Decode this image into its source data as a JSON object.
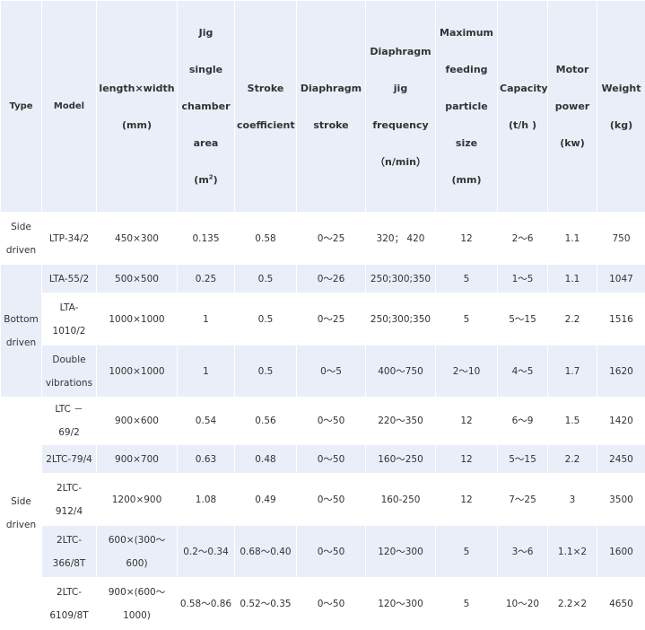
{
  "headers": {
    "type": "Type",
    "model": "Model",
    "length_width": "length×width",
    "length_width_unit": "(mm)",
    "jig_area_l1": "Jig",
    "jig_area_l2": "single",
    "jig_area_l3": "chamber",
    "jig_area_l4": "area",
    "jig_area_unit_pre": "(m",
    "jig_area_unit_sup": "2",
    "jig_area_unit_post": ")",
    "stroke_coef_l1": "Stroke",
    "stroke_coef_l2": "coefficient",
    "diaphragm_stroke_l1": "Diaphragm",
    "diaphragm_stroke_l2": "stroke",
    "jig_freq_l1": "Diaphragm",
    "jig_freq_l2": "jig",
    "jig_freq_l3": "frequency",
    "jig_freq_l4": "（n/min）",
    "max_feed_l1": "Maximum",
    "max_feed_l2": "feeding",
    "max_feed_l3": "particle",
    "max_feed_l4": "size",
    "max_feed_l5": "(mm)",
    "capacity_l1": "Capacity",
    "capacity_l2": "(t/h )",
    "motor_l1": "Motor",
    "motor_l2": "power",
    "motor_l3": "(kw)",
    "weight_l1": "Weight",
    "weight_l2": "(kg)"
  },
  "groups": {
    "side1_l1": "Side",
    "side1_l2": "driven",
    "bottom_l1": "Bottom",
    "bottom_l2": "driven",
    "side2_l1": "Side",
    "side2_l2": "driven"
  },
  "rows": [
    {
      "model_l1": "LTP-34/2",
      "model_l2": "",
      "size_l1": "450×300",
      "size_l2": "",
      "area": "0.135",
      "coef": "0.58",
      "stroke": "0～25",
      "freq": "320； 420",
      "feed": "12",
      "capacity": "2～6",
      "power": "1.1",
      "weight": "750"
    },
    {
      "model_l1": "LTA-55/2",
      "model_l2": "",
      "size_l1": "500×500",
      "size_l2": "",
      "area": "0.25",
      "coef": "0.5",
      "stroke": "0～26",
      "freq": "250;300;350",
      "feed": "5",
      "capacity": "1～5",
      "power": "1.1",
      "weight": "1047"
    },
    {
      "model_l1": "LTA-",
      "model_l2": "1010/2",
      "size_l1": "1000×1000",
      "size_l2": "",
      "area": "1",
      "coef": "0.5",
      "stroke": "0～25",
      "freq": "250;300;350",
      "feed": "5",
      "capacity": "5～15",
      "power": "2.2",
      "weight": "1516"
    },
    {
      "model_l1": "Double",
      "model_l2": "vibrations",
      "size_l1": "1000×1000",
      "size_l2": "",
      "area": "1",
      "coef": "0.5",
      "stroke": "0～5",
      "freq": "400～750",
      "feed": "2～10",
      "capacity": "4～5",
      "power": "1.7",
      "weight": "1620"
    },
    {
      "model_l1": "LTC － 69/2",
      "model_l2": "",
      "size_l1": "900×600",
      "size_l2": "",
      "area": "0.54",
      "coef": "0.56",
      "stroke": "0～50",
      "freq": "220～350",
      "feed": "12",
      "capacity": "6～9",
      "power": "1.5",
      "weight": "1420"
    },
    {
      "model_l1": "2LTC-79/4",
      "model_l2": "",
      "size_l1": "900×700",
      "size_l2": "",
      "area": "0.63",
      "coef": "0.48",
      "stroke": "0～50",
      "freq": "160～250",
      "feed": "12",
      "capacity": "5～15",
      "power": "2.2",
      "weight": "2450"
    },
    {
      "model_l1": "2LTC-",
      "model_l2": "912/4",
      "size_l1": "1200×900",
      "size_l2": "",
      "area": "1.08",
      "coef": "0.49",
      "stroke": "0～50",
      "freq": "160-250",
      "feed": "12",
      "capacity": "7～25",
      "power": "3",
      "weight": "3500"
    },
    {
      "model_l1": "2LTC-",
      "model_l2": "366/8T",
      "size_l1": "600×(300～600)",
      "size_l2": "",
      "area": "0.2～0.34",
      "coef": "0.68～0.40",
      "stroke": "0～50",
      "freq": "120～300",
      "feed": "5",
      "capacity": "3～6",
      "power": "1.1×2",
      "weight": "1600"
    },
    {
      "model_l1": "2LTC-",
      "model_l2": "6109/8T",
      "size_l1": "900×(600～",
      "size_l2": "1000)",
      "area": "0.58～0.86",
      "coef": "0.52～0.35",
      "stroke": "0～50",
      "freq": "120～300",
      "feed": "5",
      "capacity": "10～20",
      "power": "2.2×2",
      "weight": "4650"
    }
  ]
}
